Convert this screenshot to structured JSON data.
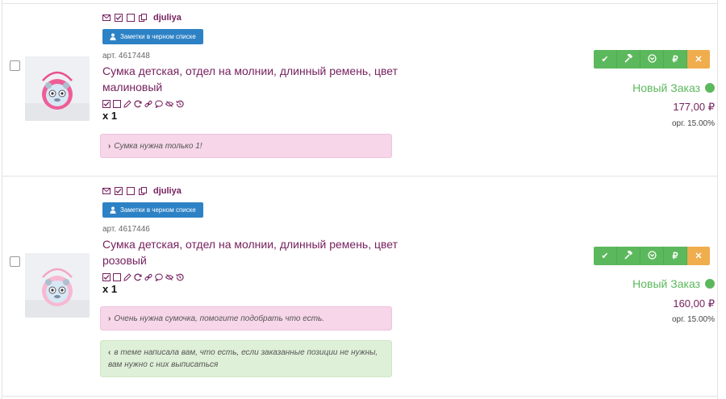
{
  "colors": {
    "brand": "#76215f",
    "blue_button": "#2d82c5",
    "success": "#5cb85c",
    "warning": "#f0ad4e",
    "note_pink": "#f6d6e8",
    "note_green": "#dff0d8"
  },
  "action_icons": [
    "check-icon",
    "hammer-icon",
    "chevron-circle-icon",
    "ruble-icon",
    "close-icon"
  ],
  "orders": [
    {
      "username": "djuliya",
      "blacklist_label": "Заметки в черном списке",
      "article": "арт. 4617448",
      "title": "Сумка детская, отдел на молнии, длинный ремень, цвет малиновый",
      "quantity": "x 1",
      "status": "Новый Заказ",
      "price": "177,00 ₽",
      "org": "орг. 15.00%",
      "notes": [
        {
          "type": "pink",
          "chevron": "›",
          "text": "Сумка нужна только 1!"
        }
      ]
    },
    {
      "username": "djuliya",
      "blacklist_label": "Заметки в черном списке",
      "article": "арт. 4617446",
      "title": "Сумка детская, отдел на молнии, длинный ремень, цвет розовый",
      "quantity": "x 1",
      "status": "Новый Заказ",
      "price": "160,00 ₽",
      "org": "орг. 15.00%",
      "notes": [
        {
          "type": "pink",
          "chevron": "›",
          "text": "Очень нужна сумочка, помогите подобрать что есть."
        },
        {
          "type": "green",
          "chevron": "‹",
          "text": "в теме написала вам, что есть, если заказанные позиции не нужны, вам нужно с них выписаться"
        }
      ]
    }
  ]
}
